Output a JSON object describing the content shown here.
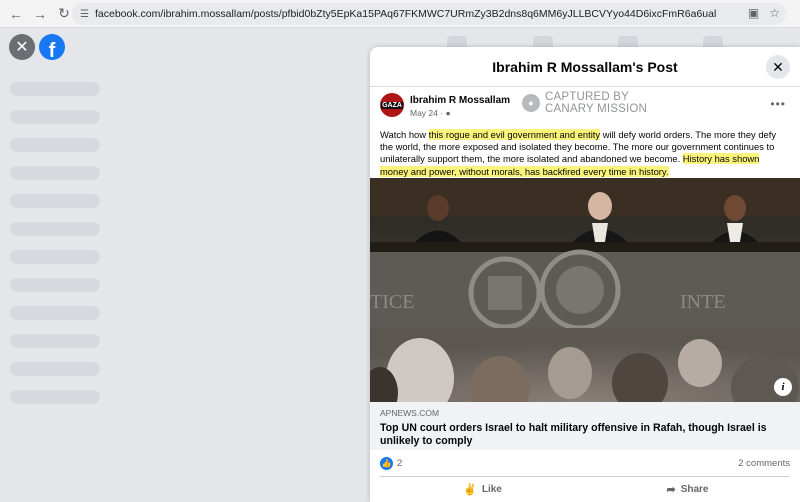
{
  "browser": {
    "url": "facebook.com/ibrahim.mossallam/posts/pfbid0bZty5EpKa15PAq67FKMWC7URmZy3B2dns8q6MM6yJLLBCVYyo44D6ixcFmR6a6ual"
  },
  "modal": {
    "title": "Ibrahim R Mossallam's Post"
  },
  "post": {
    "author": "Ibrahim R Mossallam",
    "date": "May 24 ·",
    "avatar_text": "GAZA",
    "text_parts": [
      {
        "text": "Watch how ",
        "highlight": false
      },
      {
        "text": "this rogue and evil government and entity",
        "highlight": true
      },
      {
        "text": " will defy world orders. The more they defy the world, the more exposed and isolated they become. The more our government continues to unilaterally support them, the more isolated and abandoned we become. ",
        "highlight": false
      },
      {
        "text": "History has shown money and power, without morals, has backfired every time in history.",
        "highlight": true
      }
    ]
  },
  "watermark": {
    "line1": "CAPTURED BY",
    "line2": "CANARY MISSION"
  },
  "link": {
    "domain": "APNEWS.COM",
    "title": "Top UN court orders Israel to halt military offensive in Rafah, though Israel is unlikely to comply"
  },
  "reactions": {
    "like_count": "2",
    "comments": "2 comments"
  },
  "actions": {
    "like": "Like",
    "share": "Share"
  },
  "colors": {
    "facebook_blue": "#1877f2",
    "highlight": "#fbf47a"
  }
}
